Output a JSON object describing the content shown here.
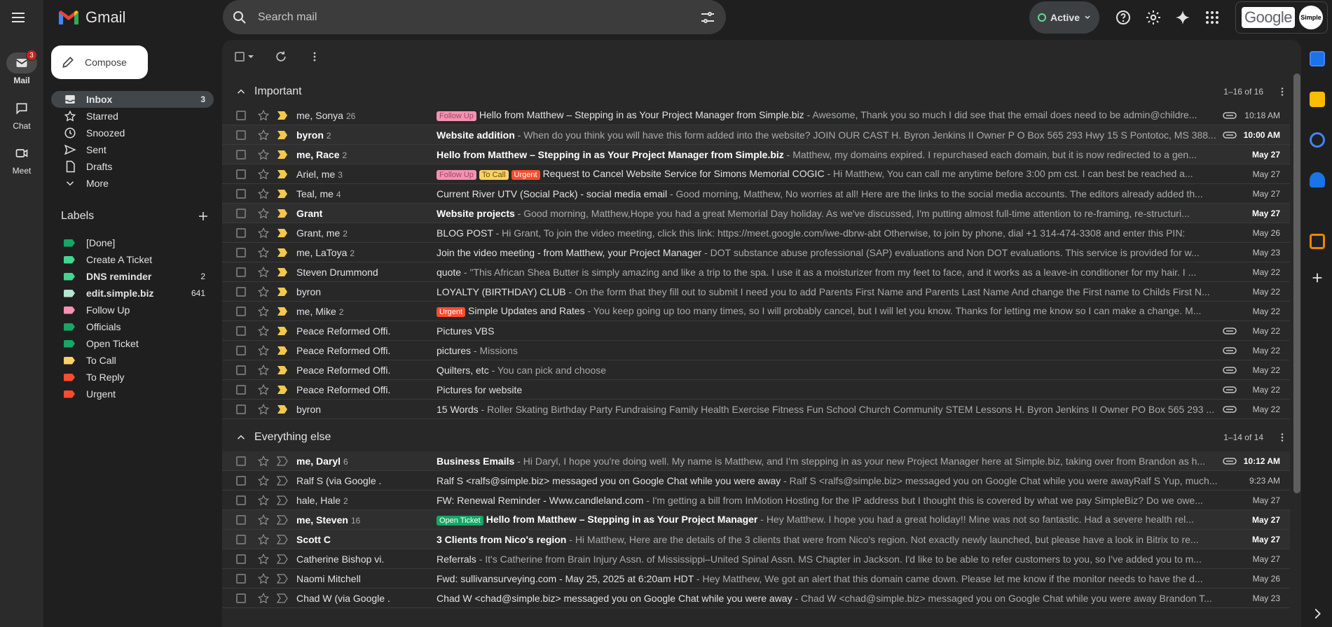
{
  "app": {
    "name": "Gmail"
  },
  "rail": {
    "mail": {
      "label": "Mail",
      "badge": "3"
    },
    "chat": {
      "label": "Chat"
    },
    "meet": {
      "label": "Meet"
    }
  },
  "search": {
    "placeholder": "Search mail"
  },
  "status": {
    "label": "Active",
    "color": "#6dd58c"
  },
  "account": {
    "brand": "Google",
    "avatar_text": "Simple"
  },
  "compose": {
    "label": "Compose"
  },
  "nav": [
    {
      "label": "Inbox",
      "count": "3",
      "icon": "inbox-icon"
    },
    {
      "label": "Starred",
      "count": "",
      "icon": "star-icon"
    },
    {
      "label": "Snoozed",
      "count": "",
      "icon": "clock-icon"
    },
    {
      "label": "Sent",
      "count": "",
      "icon": "send-icon"
    },
    {
      "label": "Drafts",
      "count": "",
      "icon": "draft-icon"
    },
    {
      "label": "More",
      "count": "",
      "icon": "chevron-down-icon"
    }
  ],
  "labels_heading": "Labels",
  "labels": [
    {
      "label": "[Done]",
      "count": "",
      "color": "#16a765",
      "bold": false
    },
    {
      "label": "Create A Ticket",
      "count": "",
      "color": "#43d692",
      "bold": false
    },
    {
      "label": "DNS reminder",
      "count": "2",
      "color": "#43d692",
      "bold": true
    },
    {
      "label": "edit.simple.biz",
      "count": "641",
      "color": "#b9e4d0",
      "bold": true
    },
    {
      "label": "Follow Up",
      "count": "",
      "color": "#f691b2",
      "bold": false
    },
    {
      "label": "Officials",
      "count": "",
      "color": "#16a765",
      "bold": false
    },
    {
      "label": "Open Ticket",
      "count": "",
      "color": "#16a765",
      "bold": false
    },
    {
      "label": "To Call",
      "count": "",
      "color": "#fad165",
      "bold": false
    },
    {
      "label": "To Reply",
      "count": "",
      "color": "#fb4c2f",
      "bold": false
    },
    {
      "label": "Urgent",
      "count": "",
      "color": "#fb4c2f",
      "bold": false
    }
  ],
  "sections": [
    {
      "title": "Important",
      "range": "1–16 of 16",
      "rows": [
        {
          "sender": "me, Sonya",
          "n": "26",
          "unread": false,
          "chips": [
            {
              "text": "Follow Up",
              "bg": "#f691b2",
              "fg": "#994a64"
            }
          ],
          "subject": "Hello from Matthew – Stepping in as Your Project Manager from Simple.biz",
          "snippet": " - Awesome, Thank you so much I did see that the email does need to be admin@childre...",
          "att": true,
          "date": "10:18 AM"
        },
        {
          "sender": "byron",
          "n": "2",
          "unread": true,
          "chips": [],
          "subject": "Website addition",
          "snippet": " - When do you think you will have this form added into the website? JOIN OUR CAST H. Byron Jenkins II Owner P O Box 565 293 Hwy 15 S Pontotoc, MS 388...",
          "att": true,
          "date": "10:00 AM"
        },
        {
          "sender": "me, Race",
          "n": "2",
          "unread": true,
          "chips": [],
          "subject": "Hello from Matthew – Stepping in as Your Project Manager from Simple.biz",
          "snippet": " - Matthew, my domains expired. I repurchased each domain, but it is now redirected to a gen...",
          "att": false,
          "date": "May 27"
        },
        {
          "sender": "Ariel, me",
          "n": "3",
          "unread": false,
          "chips": [
            {
              "text": "Follow Up",
              "bg": "#f691b2",
              "fg": "#994a64"
            },
            {
              "text": "To Call",
              "bg": "#fad165",
              "fg": "#684e07"
            },
            {
              "text": "Urgent",
              "bg": "#fb4c2f",
              "fg": "#ffffff"
            }
          ],
          "subject": "Request to Cancel Website Service for Simons Memorial COGIC",
          "snippet": " - Hi Matthew, You can call me anytime before 3:00 pm cst. I can best be reached a...",
          "att": false,
          "date": "May 27"
        },
        {
          "sender": "Teal, me",
          "n": "4",
          "unread": false,
          "chips": [],
          "subject": "Current River UTV (Social Pack) - social media email",
          "snippet": " - Good morning, Matthew, No worries at all! Here are the links to the social media accounts. The editors already added th...",
          "att": false,
          "date": "May 27"
        },
        {
          "sender": "Grant",
          "n": "",
          "unread": true,
          "chips": [],
          "subject": "Website projects",
          "snippet": " - Good morning, Matthew,Hope you had a great Memorial Day holiday. As we've discussed, I'm putting almost full-time attention to re-framing, re-structuri...",
          "att": false,
          "date": "May 27"
        },
        {
          "sender": "Grant, me",
          "n": "2",
          "unread": false,
          "chips": [],
          "subject": "BLOG POST",
          "snippet": " - Hi Grant, To join the video meeting, click this link: https://meet.google.com/iwe-dbrw-abt Otherwise, to join by phone, dial +1 314-474-3308 and enter this PIN:",
          "att": false,
          "date": "May 26"
        },
        {
          "sender": "me, LaToya",
          "n": "2",
          "unread": false,
          "chips": [],
          "subject": "Join the video meeting - from Matthew, your Project Manager",
          "snippet": " - DOT substance abuse professional (SAP) evaluations and Non DOT evaluations. This service is provided for w...",
          "att": false,
          "date": "May 23"
        },
        {
          "sender": "Steven Drummond",
          "n": "",
          "unread": false,
          "chips": [],
          "subject": "quote",
          "snippet": " - \"This African Shea Butter is simply amazing and like a trip to the spa. I use it as a moisturizer from my feet to face, and it works as a leave-in conditioner for my hair. I ...",
          "att": false,
          "date": "May 22"
        },
        {
          "sender": "byron",
          "n": "",
          "unread": false,
          "chips": [],
          "subject": "LOYALTY (BIRTHDAY) CLUB",
          "snippet": " - On the form that they fill out to submit I need you to add Parents First Name and Parents Last Name And change the First name to Childs First N...",
          "att": false,
          "date": "May 22"
        },
        {
          "sender": "me, Mike",
          "n": "2",
          "unread": false,
          "chips": [
            {
              "text": "Urgent",
              "bg": "#fb4c2f",
              "fg": "#ffffff"
            }
          ],
          "subject": "Simple Updates and Rates",
          "snippet": " - You keep going up too many times, so I will probably cancel, but I will let you know. Thanks for letting me know so I can make a change. M...",
          "att": false,
          "date": "May 22"
        },
        {
          "sender": "Peace Reformed Offi.",
          "n": "",
          "unread": false,
          "chips": [],
          "subject": "Pictures VBS",
          "snippet": "",
          "att": true,
          "date": "May 22"
        },
        {
          "sender": "Peace Reformed Offi.",
          "n": "",
          "unread": false,
          "chips": [],
          "subject": "pictures",
          "snippet": " - Missions",
          "att": true,
          "date": "May 22"
        },
        {
          "sender": "Peace Reformed Offi.",
          "n": "",
          "unread": false,
          "chips": [],
          "subject": "Quilters, etc",
          "snippet": " - You can pick and choose",
          "att": true,
          "date": "May 22"
        },
        {
          "sender": "Peace Reformed Offi.",
          "n": "",
          "unread": false,
          "chips": [],
          "subject": "Pictures for website",
          "snippet": "",
          "att": true,
          "date": "May 22"
        },
        {
          "sender": "byron",
          "n": "",
          "unread": false,
          "chips": [],
          "subject": "15 Words",
          "snippet": " - Roller Skating Birthday Party Fundraising Family Health Exercise Fitness Fun School Church Community STEM Lessons H. Byron Jenkins II Owner PO Box 565 293 ...",
          "att": true,
          "date": "May 22"
        }
      ]
    },
    {
      "title": "Everything else",
      "range": "1–14 of 14",
      "rows": [
        {
          "sender": "me, Daryl",
          "n": "6",
          "unread": true,
          "chips": [],
          "subject": "Business Emails",
          "snippet": " - Hi Daryl, I hope you're doing well. My name is Matthew, and I'm stepping in as your new Project Manager here at Simple.biz, taking over from Brandon as h...",
          "att": true,
          "date": "10:12 AM"
        },
        {
          "sender": "Ralf S (via Google .",
          "n": "",
          "unread": false,
          "chips": [],
          "subject": "Ralf S <ralfs@simple.biz> messaged you on Google Chat while you were away",
          "snippet": " - Ralf S <ralfs@simple.biz> messaged you on Google Chat while you were awayRalf S Yup, much...",
          "att": false,
          "date": "9:23 AM"
        },
        {
          "sender": "hale, Hale",
          "n": "2",
          "unread": false,
          "chips": [],
          "subject": "FW: Renewal Reminder - Www.candleland.com",
          "snippet": " - I'm getting a bill from InMotion Hosting for the IP address but I thought this is covered by what we pay SimpleBiz? Do we owe...",
          "att": false,
          "date": "May 27"
        },
        {
          "sender": "me, Steven",
          "n": "16",
          "unread": true,
          "chips": [
            {
              "text": "Open Ticket",
              "bg": "#16a765",
              "fg": "#ffffff"
            }
          ],
          "subject": "Hello from Matthew – Stepping in as Your Project Manager",
          "snippet": " - Hey Matthew. I hope you had a great holiday!! Mine was not so fantastic. Had a severe health rel...",
          "att": false,
          "date": "May 27"
        },
        {
          "sender": "Scott C",
          "n": "",
          "unread": true,
          "chips": [],
          "subject": "3 Clients from Nico's region",
          "snippet": " - Hi Matthew, Here are the details of the 3 clients that were from Nico's region. Not exactly newly launched, but please have a look in Bitrix to re...",
          "att": false,
          "date": "May 27"
        },
        {
          "sender": "Catherine Bishop vi.",
          "n": "",
          "unread": false,
          "chips": [],
          "subject": "Referrals",
          "snippet": " - It's Catherine from Brain Injury Assn. of Mississippi–United Spinal Assn. MS Chapter in Jackson. I'd like to be able to refer customers to you, so I've added you to m...",
          "att": false,
          "date": "May 27"
        },
        {
          "sender": "Naomi Mitchell",
          "n": "",
          "unread": false,
          "chips": [],
          "subject": "Fwd: sullivansurveying.com - May 25, 2025 at 6:20am HDT",
          "snippet": " - Hey Matthew, We got an alert that this domain came down. Please let me know if the monitor needs to have the d...",
          "att": false,
          "date": "May 26"
        },
        {
          "sender": "Chad W (via Google .",
          "n": "",
          "unread": false,
          "chips": [],
          "subject": "Chad W <chad@simple.biz> messaged you on Google Chat while you were away",
          "snippet": " - Chad W <chad@simple.biz> messaged you on Google Chat while you were away Brandon T...",
          "att": false,
          "date": "May 23"
        }
      ]
    }
  ]
}
